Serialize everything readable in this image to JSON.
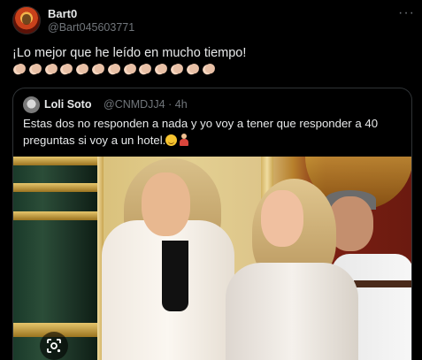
{
  "tweet": {
    "author_name": "Bart0",
    "author_handle": "@Bart045603771",
    "more_label": "···",
    "text": "¡Lo mejor que he leído en mucho tiempo!",
    "emoji_count": 13
  },
  "quoted": {
    "author_name": "Loli Soto",
    "author_handle": "@CNMDJJ4 · 4h",
    "text": "Estas dos no responden a nada y yo voy a tener que responder a 40 preguntas si voy a un hotel."
  },
  "icons": {
    "avatar": "avatar-icon",
    "lens": "google-lens-icon",
    "clap": "clapping-hands-icon"
  }
}
